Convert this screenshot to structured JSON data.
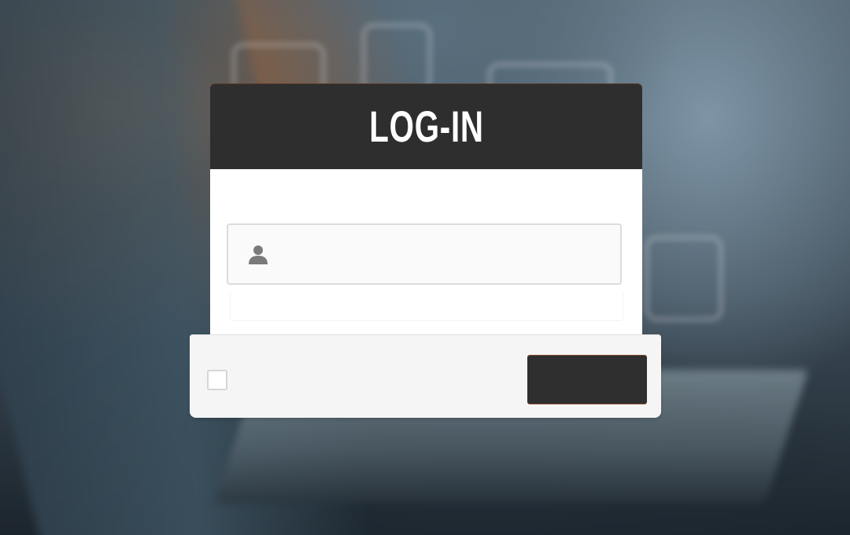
{
  "header": {
    "title": "LOG-IN"
  },
  "form": {
    "username": {
      "icon": "user-icon",
      "value": "",
      "placeholder": ""
    },
    "password": {
      "value": "",
      "placeholder": ""
    },
    "remember": {
      "checked": false,
      "label": ""
    },
    "submit_label": ""
  },
  "colors": {
    "header_bg": "#2e2e2e",
    "header_text": "#ffffff",
    "submit_bg": "#2f2f2f",
    "accent_edge": "#8a4a30"
  }
}
